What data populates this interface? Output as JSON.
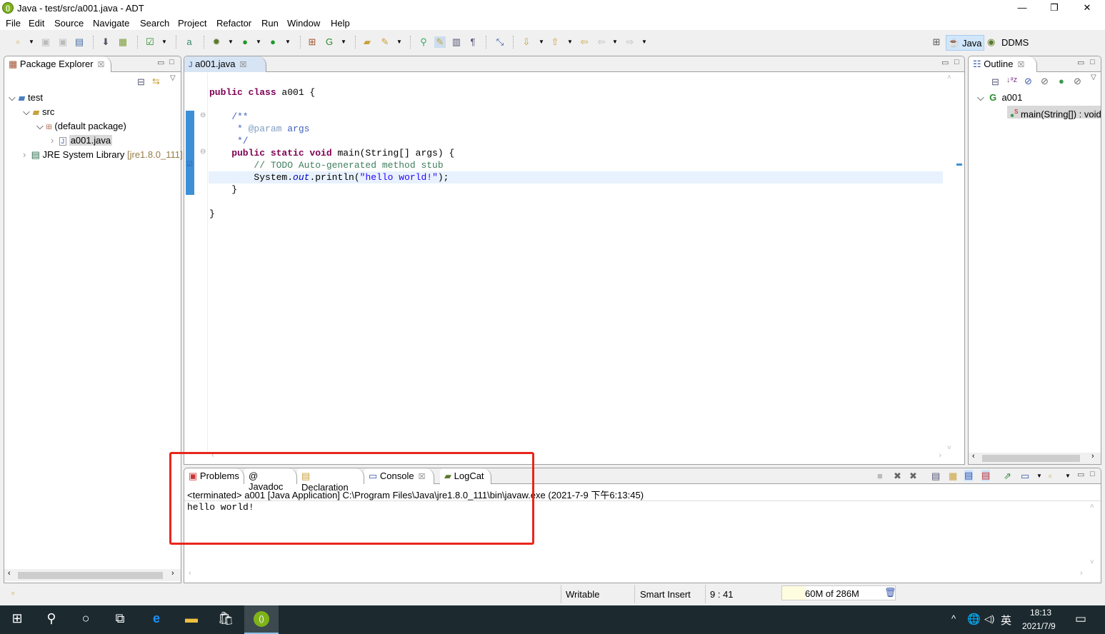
{
  "window": {
    "title": "Java - test/src/a001.java - ADT",
    "minimize": "—",
    "restore": "❐",
    "close": "✕"
  },
  "menu": [
    "File",
    "Edit",
    "Source",
    "Navigate",
    "Search",
    "Project",
    "Refactor",
    "Run",
    "Window",
    "Help"
  ],
  "perspectives": {
    "java": "Java",
    "ddms": "DDMS"
  },
  "package_explorer": {
    "tab": "Package Explorer",
    "tree": [
      {
        "label": "test",
        "icon": "project-icon",
        "expanded": true
      },
      {
        "label": "src",
        "icon": "source-folder-icon",
        "expanded": true
      },
      {
        "label": "(default package)",
        "icon": "package-icon",
        "expanded": true
      },
      {
        "label": "a001.java",
        "icon": "java-file-icon",
        "selected": true
      },
      {
        "label": "JRE System Library",
        "suffix": "[jre1.8.0_111]",
        "icon": "library-icon"
      }
    ]
  },
  "editor": {
    "tab": "a001.java",
    "code": [
      [
        [
          "public class ",
          "kw"
        ],
        [
          "a001 {",
          ""
        ]
      ],
      [],
      [
        [
          "    /**",
          "cm"
        ]
      ],
      [
        [
          "     * ",
          "cm"
        ],
        [
          "@param",
          "tag"
        ],
        [
          " args",
          "cm"
        ]
      ],
      [
        [
          "     */",
          "cm"
        ]
      ],
      [
        [
          "    public static void ",
          "kw"
        ],
        [
          "main(String[] args) {",
          ""
        ]
      ],
      [
        [
          "        // TODO Auto-generated method stub",
          "lc"
        ]
      ],
      [
        [
          "        System.",
          ""
        ],
        [
          "out",
          "fd"
        ],
        [
          ".println(",
          ""
        ],
        [
          "\"hello world!\"",
          "st"
        ],
        [
          ");",
          ""
        ]
      ],
      [
        [
          "    }",
          ""
        ]
      ],
      [],
      [
        [
          "}",
          ""
        ]
      ]
    ]
  },
  "outline": {
    "tab": "Outline",
    "class": "a001",
    "method": "main(String[]) : void"
  },
  "bottom": {
    "tabs": [
      "Problems",
      "Javadoc",
      "Declaration",
      "Console",
      "LogCat"
    ],
    "active_tab": "Console",
    "console_header": "<terminated> a001 [Java Application] C:\\Program Files\\Java\\jre1.8.0_111\\bin\\javaw.exe (2021-7-9 下午6:13:45)",
    "console_output": "hello world!"
  },
  "status": {
    "writable": "Writable",
    "insert_mode": "Smart Insert",
    "position": "9 : 41",
    "heap": "60M of 286M",
    "heap_used_fraction": 0.21
  },
  "taskbar": {
    "time": "18:13",
    "date": "2021/7/9",
    "ime": "英"
  },
  "colors": {
    "highlight_box": "#e8261c",
    "taskbar": "#1c2a30",
    "selection": "#d6e4f4"
  }
}
